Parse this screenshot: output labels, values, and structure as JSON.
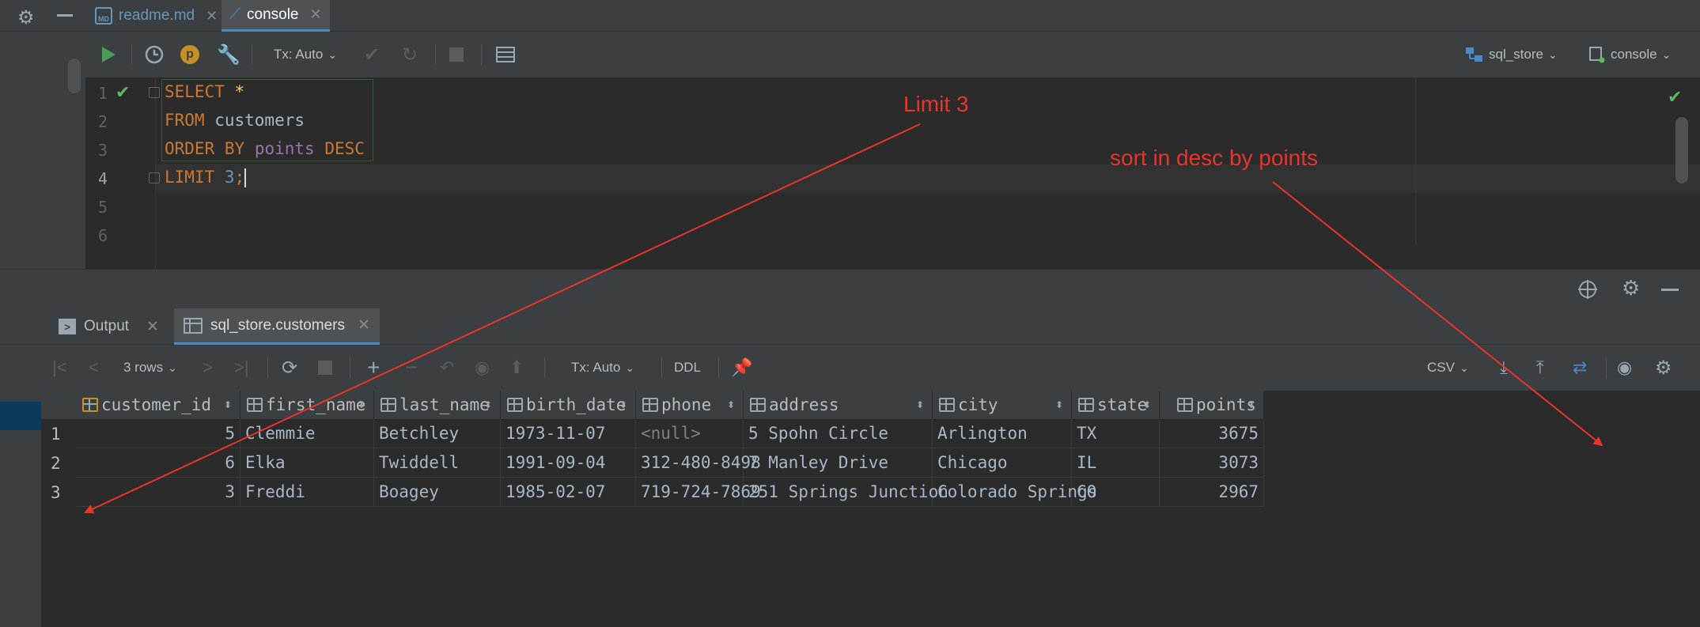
{
  "tabs": [
    {
      "label": "readme.md"
    },
    {
      "label": "console"
    }
  ],
  "toolbar": {
    "tx_mode": "Tx: Auto",
    "datasource": "sql_store",
    "session": "console"
  },
  "editor": {
    "line_numbers": [
      "1",
      "2",
      "3",
      "4",
      "5",
      "6"
    ]
  },
  "annotations": {
    "limit": "Limit 3",
    "sort": "sort in desc by points"
  },
  "results": {
    "tabs": [
      {
        "label": "Output"
      },
      {
        "label": "sql_store.customers"
      }
    ],
    "rows_label": "3 rows",
    "tx_mode": "Tx: Auto",
    "ddl_label": "DDL",
    "export_format": "CSV",
    "columns": [
      "customer_id",
      "first_name",
      "last_name",
      "birth_date",
      "phone",
      "address",
      "city",
      "state",
      "points"
    ],
    "rows": [
      {
        "n": "1",
        "cells": [
          "5",
          "Clemmie",
          "Betchley",
          "1973-11-07",
          "<null>",
          "5 Spohn Circle",
          "Arlington",
          "TX",
          "3675"
        ]
      },
      {
        "n": "2",
        "cells": [
          "6",
          "Elka",
          "Twiddell",
          "1991-09-04",
          "312-480-8498",
          "7 Manley Drive",
          "Chicago",
          "IL",
          "3073"
        ]
      },
      {
        "n": "3",
        "cells": [
          "3",
          "Freddi",
          "Boagey",
          "1985-02-07",
          "719-724-7869",
          "251 Springs Junction",
          "Colorado Springs",
          "CO",
          "2967"
        ]
      }
    ]
  },
  "colors": {
    "accent": "#4a88c7",
    "keyword": "#cc7832",
    "annotation": "#e8352c",
    "run_green": "#499c54"
  }
}
